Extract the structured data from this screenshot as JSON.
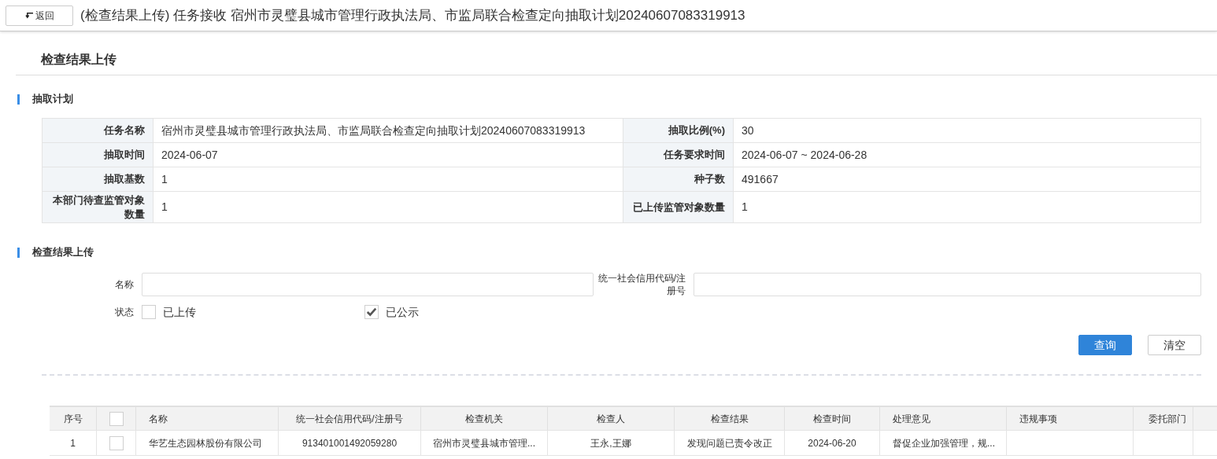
{
  "header": {
    "back_button": "返回",
    "title": "(检查结果上传) 任务接收 宿州市灵璧县城市管理行政执法局、市监局联合检查定向抽取计划20240607083319913"
  },
  "page_title": "检查结果上传",
  "plan": {
    "heading": "抽取计划",
    "rows": [
      {
        "cells": [
          {
            "label": "任务名称",
            "value": "宿州市灵璧县城市管理行政执法局、市监局联合检查定向抽取计划20240607083319913"
          },
          {
            "label": "抽取比例(%)",
            "value": "30"
          }
        ]
      },
      {
        "cells": [
          {
            "label": "抽取时间",
            "value": "2024-06-07"
          },
          {
            "label": "任务要求时间",
            "value": "2024-06-07 ~ 2024-06-28"
          }
        ]
      },
      {
        "cells": [
          {
            "label": "抽取基数",
            "value": "1"
          },
          {
            "label": "种子数",
            "value": "491667"
          }
        ]
      },
      {
        "cells": [
          {
            "label": "本部门待查监管对象数量",
            "value": "1"
          },
          {
            "label": "已上传监管对象数量",
            "value": "1"
          }
        ]
      }
    ]
  },
  "upload": {
    "heading": "检查结果上传",
    "fields": [
      {
        "label": "名称"
      },
      {
        "label": "统一社会信用代码/注册号"
      }
    ],
    "status": {
      "label": "状态",
      "options": [
        {
          "label": "已上传",
          "checked": false
        },
        {
          "label": "已公示",
          "checked": true
        }
      ]
    },
    "buttons": [
      {
        "kind": "primary",
        "label": "查询"
      },
      {
        "kind": "default",
        "label": "清空"
      }
    ]
  },
  "table": {
    "columns": [
      {
        "kind": "text",
        "label": "序号"
      },
      {
        "kind": "checkbox",
        "checked": false
      },
      {
        "kind": "text",
        "label": "名称"
      },
      {
        "kind": "text",
        "label": "统一社会信用代码/注册号"
      },
      {
        "kind": "text",
        "label": "检查机关"
      },
      {
        "kind": "text",
        "label": "检查人"
      },
      {
        "kind": "text",
        "label": "检查结果"
      },
      {
        "kind": "text",
        "label": "检查时间"
      },
      {
        "kind": "text",
        "label": "处理意见"
      },
      {
        "kind": "text",
        "label": "违规事项"
      },
      {
        "kind": "text",
        "label": "委托部门"
      }
    ],
    "rows": [
      {
        "cells": [
          {
            "kind": "text",
            "text": "1"
          },
          {
            "kind": "checkbox",
            "checked": false
          },
          {
            "kind": "text",
            "text": "华艺生态园林股份有限公司"
          },
          {
            "kind": "text",
            "text": "913401001492059280"
          },
          {
            "kind": "text",
            "text": "宿州市灵璧县城市管理..."
          },
          {
            "kind": "text",
            "text": "王永,王娜"
          },
          {
            "kind": "text",
            "text": "发现问题已责令改正"
          },
          {
            "kind": "text",
            "text": "2024-06-20"
          },
          {
            "kind": "text",
            "text": "督促企业加强管理，规..."
          }
        ]
      }
    ]
  }
}
